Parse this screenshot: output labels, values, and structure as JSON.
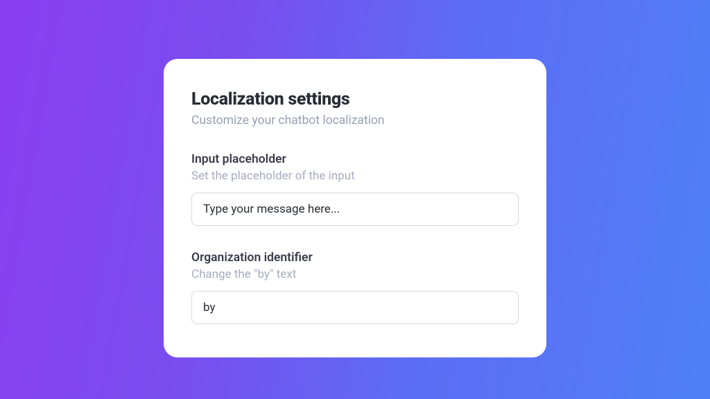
{
  "card": {
    "title": "Localization settings",
    "subtitle": "Customize your chatbot localization",
    "fields": {
      "input_placeholder": {
        "label": "Input placeholder",
        "help": "Set the placeholder of the input",
        "value": "Type your message here..."
      },
      "organization_identifier": {
        "label": "Organization identifier",
        "help": "Change the \"by\" text",
        "value": "by"
      }
    }
  }
}
